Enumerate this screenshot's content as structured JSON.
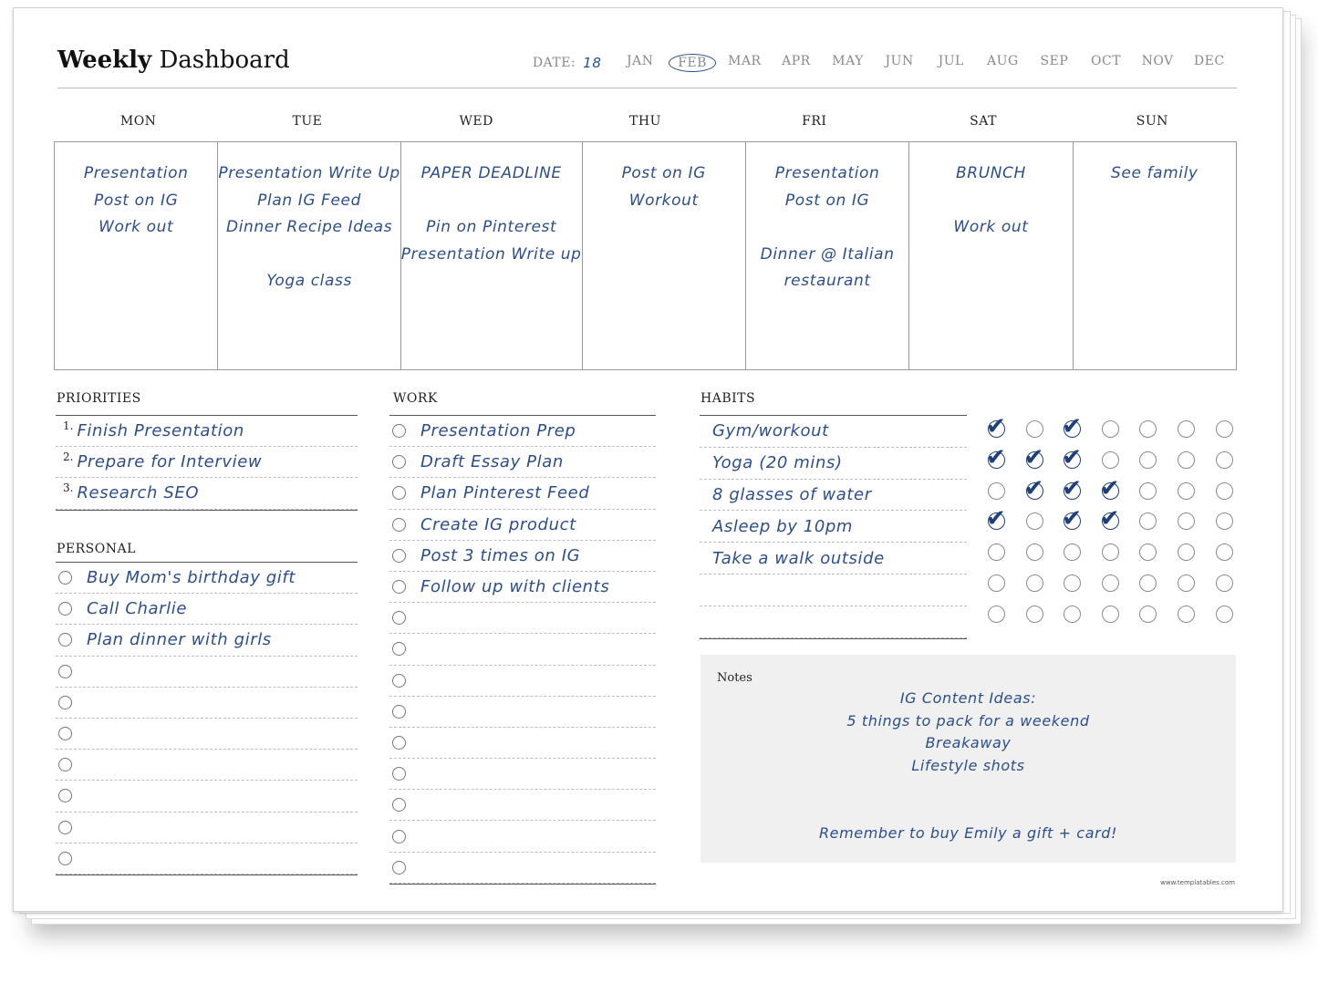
{
  "header": {
    "title_bold": "Weekly",
    "title_rest": "Dashboard",
    "date_label": "DATE:",
    "date_day": "18",
    "months": [
      "JAN",
      "FEB",
      "MAR",
      "APR",
      "MAY",
      "JUN",
      "JUL",
      "AUG",
      "SEP",
      "OCT",
      "NOV",
      "DEC"
    ],
    "selected_month": "FEB"
  },
  "week": [
    {
      "day": "MON",
      "lines": [
        "Presentation",
        "Post on IG",
        "Work out"
      ]
    },
    {
      "day": "TUE",
      "lines": [
        "Presentation Write Up",
        "Plan IG Feed",
        "Dinner Recipe Ideas",
        "",
        "Yoga class"
      ]
    },
    {
      "day": "WED",
      "lines": [
        "PAPER DEADLINE",
        "",
        "Pin on Pinterest",
        "Presentation Write up"
      ]
    },
    {
      "day": "THU",
      "lines": [
        "Post on IG",
        "Workout"
      ]
    },
    {
      "day": "FRI",
      "lines": [
        "Presentation",
        "Post on IG",
        "",
        "Dinner @ Italian",
        "restaurant"
      ]
    },
    {
      "day": "SAT",
      "lines": [
        "BRUNCH",
        "",
        "Work out"
      ]
    },
    {
      "day": "SUN",
      "lines": [
        "See family"
      ]
    }
  ],
  "priorities": {
    "title": "PRIORITIES",
    "items": [
      {
        "num": "1.",
        "text": "Finish Presentation"
      },
      {
        "num": "2.",
        "text": "Prepare for Interview"
      },
      {
        "num": "3.",
        "text": "Research SEO"
      }
    ]
  },
  "personal": {
    "title": "PERSONAL",
    "items": [
      "Buy Mom's birthday gift",
      "Call Charlie",
      "Plan dinner with girls",
      "",
      "",
      "",
      "",
      "",
      "",
      ""
    ]
  },
  "work": {
    "title": "WORK",
    "items": [
      "Presentation Prep",
      "Draft Essay Plan",
      "Plan Pinterest Feed",
      "Create IG product",
      "Post 3 times on IG",
      "Follow up with clients",
      "",
      "",
      "",
      "",
      "",
      "",
      "",
      "",
      ""
    ]
  },
  "habits": {
    "title": "HABITS",
    "rows": [
      {
        "name": "Gym/workout",
        "checks": [
          1,
          0,
          1,
          0,
          0,
          0,
          0
        ]
      },
      {
        "name": "Yoga (20 mins)",
        "checks": [
          1,
          1,
          1,
          0,
          0,
          0,
          0
        ]
      },
      {
        "name": "8 glasses of water",
        "checks": [
          0,
          1,
          1,
          1,
          0,
          0,
          0
        ]
      },
      {
        "name": "Asleep by 10pm",
        "checks": [
          1,
          0,
          1,
          1,
          0,
          0,
          0
        ]
      },
      {
        "name": "Take a walk outside",
        "checks": [
          0,
          0,
          0,
          0,
          0,
          0,
          0
        ]
      },
      {
        "name": "",
        "checks": [
          0,
          0,
          0,
          0,
          0,
          0,
          0
        ]
      },
      {
        "name": "",
        "checks": [
          0,
          0,
          0,
          0,
          0,
          0,
          0
        ]
      }
    ]
  },
  "notes": {
    "label": "Notes",
    "lines": [
      "IG Content Ideas:",
      "5 things to pack for a weekend",
      "Breakaway",
      "Lifestyle shots",
      "",
      "",
      "Remember to buy Emily a gift + card!"
    ]
  },
  "footer_url": "www.templatables.com",
  "colors": {
    "ink": "#2c4f8c",
    "check": "#1f3f7a"
  }
}
